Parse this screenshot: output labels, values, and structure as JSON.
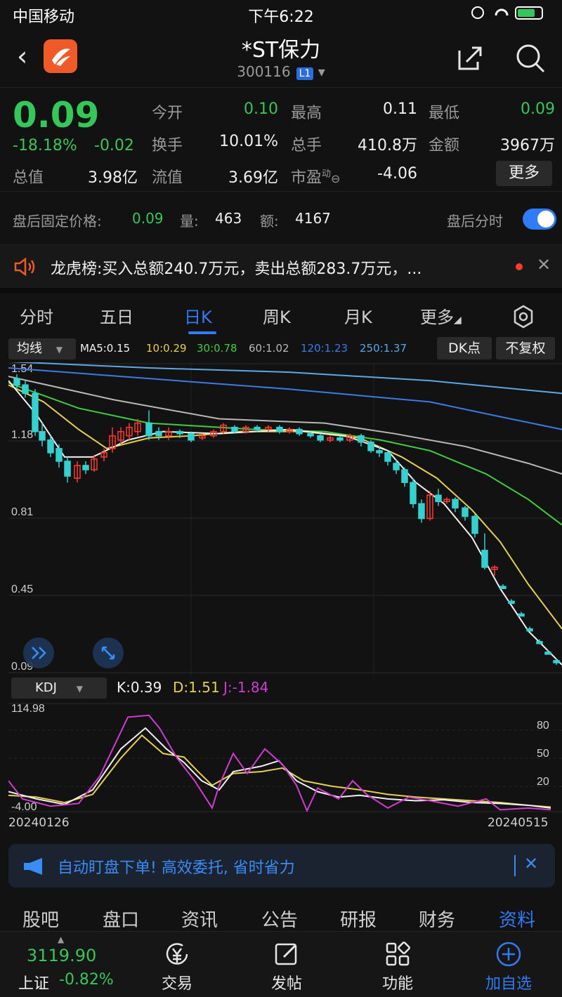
{
  "status_bar": {
    "carrier": "中国移动",
    "time": "下午6:22"
  },
  "header": {
    "title": "*ST保力",
    "code": "300116",
    "level": "L1"
  },
  "quote": {
    "price": "0.09",
    "change_pct": "-18.18%",
    "change": "-0.02",
    "rows": [
      [
        {
          "label": "今开",
          "value": "0.10",
          "color": "green"
        },
        {
          "label": "最高",
          "value": "0.11",
          "color": "white"
        },
        {
          "label": "最低",
          "value": "0.09",
          "color": "green"
        }
      ],
      [
        {
          "label": "换手",
          "value": "10.01%",
          "color": "white"
        },
        {
          "label": "总手",
          "value": "410.8万",
          "color": "white"
        },
        {
          "label": "金额",
          "value": "3967万",
          "color": "white"
        }
      ],
      [
        {
          "label": "总值",
          "value": "3.98亿",
          "color": "white"
        },
        {
          "label": "流值",
          "value": "3.69亿",
          "color": "white"
        },
        {
          "label": "市盈",
          "value": "-4.06",
          "color": "white"
        }
      ]
    ],
    "pe_sup": "动",
    "more_label": "更多"
  },
  "after_hours": {
    "label": "盘后固定价格:",
    "price": "0.09",
    "vol_label": "量:",
    "vol": "463",
    "amt_label": "额:",
    "amt": "4167",
    "toggle_label": "盘后分时"
  },
  "news": {
    "tag": "龙虎榜:",
    "text": "买入总额240.7万元，卖出总额283.7万元，..."
  },
  "tabs": [
    "分时",
    "五日",
    "日K",
    "周K",
    "月K",
    "更多"
  ],
  "ma_bar": {
    "selector": "均线",
    "items": [
      {
        "text": "MA5:0.15",
        "color": "#f0f0f0"
      },
      {
        "text": "10:0.29",
        "color": "#e6d04a"
      },
      {
        "text": "30:0.78",
        "color": "#3ecf3e"
      },
      {
        "text": "60:1.02",
        "color": "#b8b8b8"
      },
      {
        "text": "120:1.23",
        "color": "#3a7be8"
      },
      {
        "text": "250:1.37",
        "color": "#5aa8e8"
      }
    ],
    "dk_label": "DK点",
    "adj_label": "不复权"
  },
  "kline_axis": [
    "1.54",
    "1.18",
    "0.81",
    "0.45",
    "0.09"
  ],
  "kdj": {
    "selector": "KDJ",
    "k": "K:0.39",
    "d": "D:1.51",
    "j": "J:-1.84",
    "axis_top": "114.98",
    "axis_bottom": "-4.00",
    "levels": [
      "80",
      "50",
      "20"
    ]
  },
  "dates": {
    "start": "20240126",
    "end": "20240515"
  },
  "promo": {
    "text": "自动盯盘下单! 高效委托, 省时省力"
  },
  "info_tabs": [
    "股吧",
    "盘口",
    "资讯",
    "公告",
    "研报",
    "财务",
    "资料"
  ],
  "bottom_nav": {
    "index_value": "3119.90",
    "index_name": "上证",
    "index_change": "-0.82%",
    "items": [
      "交易",
      "发帖",
      "功能",
      "加自选"
    ]
  },
  "colors": {
    "up": "#ff3b30",
    "down": "#34c759",
    "accent": "#2f7cf6",
    "candle_down": "#35d0d0"
  }
}
